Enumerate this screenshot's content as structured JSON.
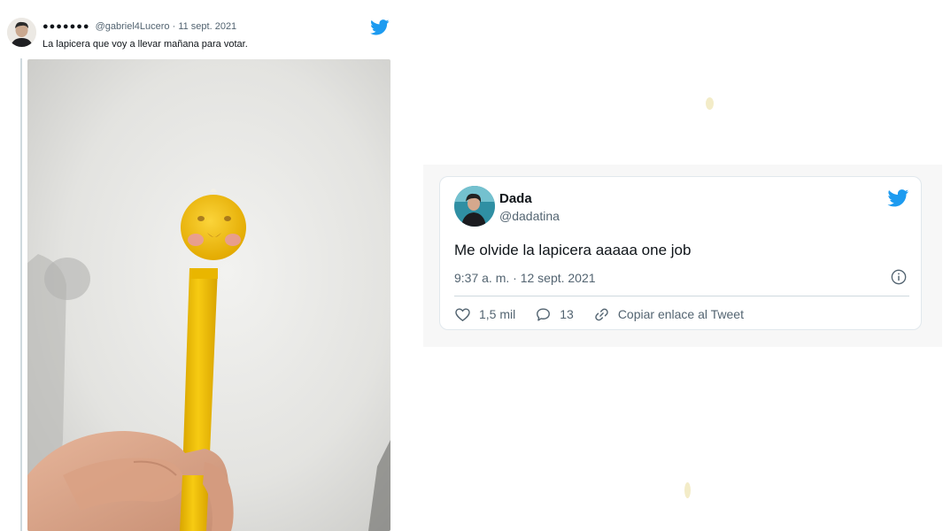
{
  "colors": {
    "twitter_blue": "#1d9bf0",
    "muted_text": "#536471",
    "pen_yellow": "#f2c200"
  },
  "left_tweet": {
    "display_name": "●●●●●●●",
    "handle": "@gabriel4Lucero",
    "separator": "·",
    "date": "11 sept. 2021",
    "text": "La lapicera que voy a llevar mañana para votar.",
    "icons": [
      "avatar",
      "twitter-bird-icon"
    ]
  },
  "right_tweet": {
    "name": "Dada",
    "handle": "@dadatina",
    "text": "Me olvide la lapicera aaaaa one job",
    "time": "9:37 a. m. · 12 sept. 2021",
    "actions": {
      "likes": "1,5 mil",
      "replies": "13",
      "copy_link": "Copiar enlace al Tweet"
    },
    "icons": [
      "twitter-bird-icon",
      "info-icon",
      "heart-icon",
      "comment-icon",
      "link-icon"
    ]
  }
}
